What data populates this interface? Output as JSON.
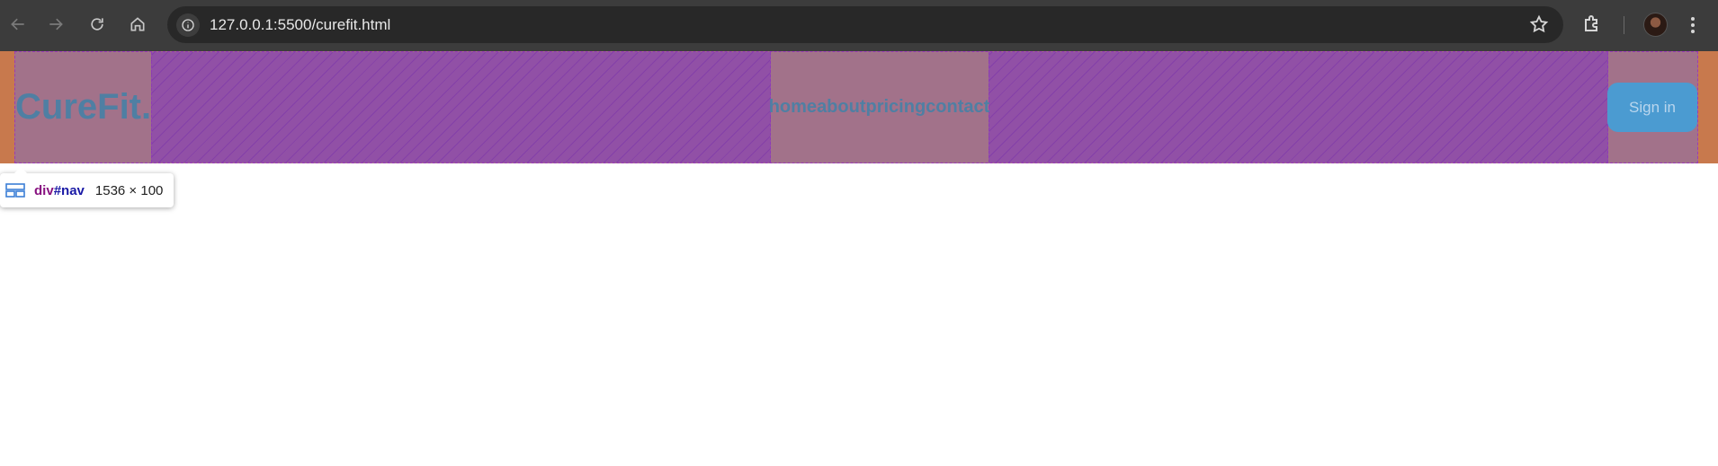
{
  "browser": {
    "url": "127.0.0.1:5500/curefit.html"
  },
  "page": {
    "logo": "CureFit.",
    "nav_links": [
      "home",
      "about",
      "pricing",
      "contact"
    ],
    "signin_label": "Sign in"
  },
  "inspector": {
    "tag": "div",
    "id": "#nav",
    "size": "1536 × 100"
  },
  "colors": {
    "margin_highlight": "#c8794d",
    "content_highlight": "#a2728a",
    "gap_highlight": "#9150a6",
    "logo_text": "#4f7fa3",
    "signin_bg": "#4b9bd1"
  }
}
